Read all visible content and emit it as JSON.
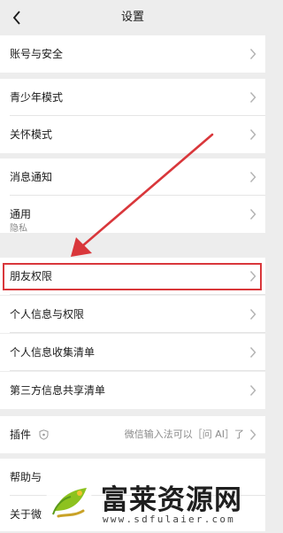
{
  "nav": {
    "title": "设置",
    "back_icon": "chevron-left-icon"
  },
  "settings": {
    "account_security": "账号与安全",
    "teen_mode": "青少年模式",
    "care_mode": "关怀模式",
    "notifications": "消息通知",
    "general": "通用",
    "privacy_header": "隐私",
    "friend_permissions": "朋友权限",
    "personal_info_permissions": "个人信息与权限",
    "personal_info_list": "个人信息收集清单",
    "third_party_list": "第三方信息共享清单",
    "plugins": "插件",
    "plugins_value": "微信输入法可以［问 AI］了",
    "help": "帮助与",
    "about": "关于微"
  },
  "annotation": {
    "highlight_color": "#d9373b",
    "arrow_color": "#d9373b"
  },
  "watermark": {
    "name": "富莱资源网",
    "url": "www.sdfulaier.com",
    "logo_icon": "leaf-seedling-logo"
  }
}
